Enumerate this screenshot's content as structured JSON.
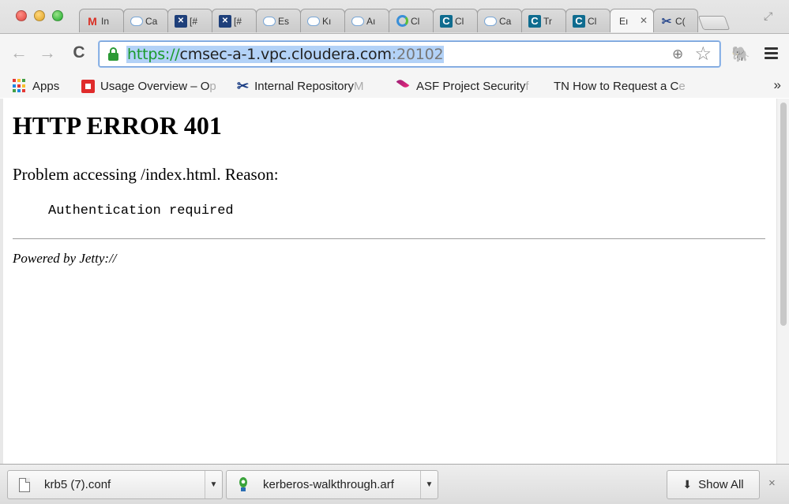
{
  "window": {
    "tabs": [
      {
        "label": "In",
        "icon": "gmail-icon"
      },
      {
        "label": "Ca",
        "icon": "cloud-icon"
      },
      {
        "label": "[#",
        "icon": "jira-shield-icon"
      },
      {
        "label": "[#",
        "icon": "jira-shield-icon"
      },
      {
        "label": "Es",
        "icon": "cloud-icon"
      },
      {
        "label": "Kı",
        "icon": "cloud-icon"
      },
      {
        "label": "Aı",
        "icon": "cloud-icon"
      },
      {
        "label": "Cl",
        "icon": "circle-logo-icon"
      },
      {
        "label": "Cl",
        "icon": "cloudera-c-icon"
      },
      {
        "label": "Ca",
        "icon": "cloud-icon"
      },
      {
        "label": "Tr",
        "icon": "cloudera-c-icon"
      },
      {
        "label": "Cl",
        "icon": "cloudera-c-icon"
      },
      {
        "label": "Eı",
        "icon": "none",
        "active": true
      },
      {
        "label": "C(",
        "icon": "scissors-x-icon"
      }
    ],
    "active_tab_close": "✕"
  },
  "toolbar": {
    "url_scheme": "https://",
    "url_host": "cmsec-a-1.vpc.cloudera.com",
    "url_port": ":20102"
  },
  "bookmarks": {
    "items": [
      {
        "label": "Apps",
        "fade": ""
      },
      {
        "label": "Usage Overview – O",
        "fade": "p"
      },
      {
        "label": "Internal Repository",
        "fade": " M"
      },
      {
        "label": "ASF Project Security",
        "fade": " f"
      },
      {
        "label": "TN How to Request a C",
        "fade": "e"
      }
    ],
    "overflow": "»"
  },
  "page": {
    "heading": "HTTP ERROR 401",
    "reason": "Problem accessing /index.html. Reason:",
    "message": "Authentication required",
    "powered_by": "Powered by Jetty://"
  },
  "downloads": {
    "items": [
      {
        "name": "krb5 (7).conf"
      },
      {
        "name": "kerberos-walkthrough.arf"
      }
    ],
    "show_all": "Show All",
    "close": "×"
  },
  "colors": {
    "secure_green": "#1a9a2c",
    "url_selection": "#b3d2f7",
    "omnibox_focus": "#6b9ad6"
  }
}
